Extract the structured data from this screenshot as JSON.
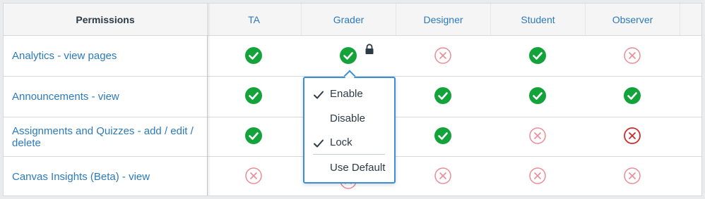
{
  "table": {
    "permissions_header": "Permissions",
    "roles": [
      "TA",
      "Grader",
      "Designer",
      "Student",
      "Observer"
    ],
    "rows": [
      {
        "label": "Analytics - view pages",
        "states": [
          "enabled",
          "enabled-locked",
          "disabled",
          "enabled",
          "disabled"
        ]
      },
      {
        "label": "Announcements - view",
        "states": [
          "enabled",
          "menu",
          "enabled",
          "enabled",
          "enabled"
        ]
      },
      {
        "label": "Assignments and Quizzes - add / edit / delete",
        "states": [
          "enabled",
          "menu",
          "enabled",
          "disabled",
          "disabled-strong"
        ]
      },
      {
        "label": "Canvas Insights (Beta) - view",
        "states": [
          "disabled",
          "menu",
          "disabled",
          "disabled",
          "disabled"
        ]
      }
    ]
  },
  "menu": {
    "items": [
      {
        "label": "Enable",
        "checked": true
      },
      {
        "label": "Disable",
        "checked": false
      },
      {
        "label": "Lock",
        "checked": true
      },
      {
        "label": "Use Default",
        "checked": false
      }
    ]
  },
  "icons": {
    "enabled": "check-circle-icon",
    "disabled": "x-circle-icon",
    "lock": "lock-icon",
    "menu_check": "checkmark-icon"
  },
  "colors": {
    "enabled": "#13a33a",
    "disabled": "#ea8c95",
    "disabled_strong": "#cf2a2a",
    "link": "#2b7abc",
    "menu_border": "#3a8fd8"
  }
}
